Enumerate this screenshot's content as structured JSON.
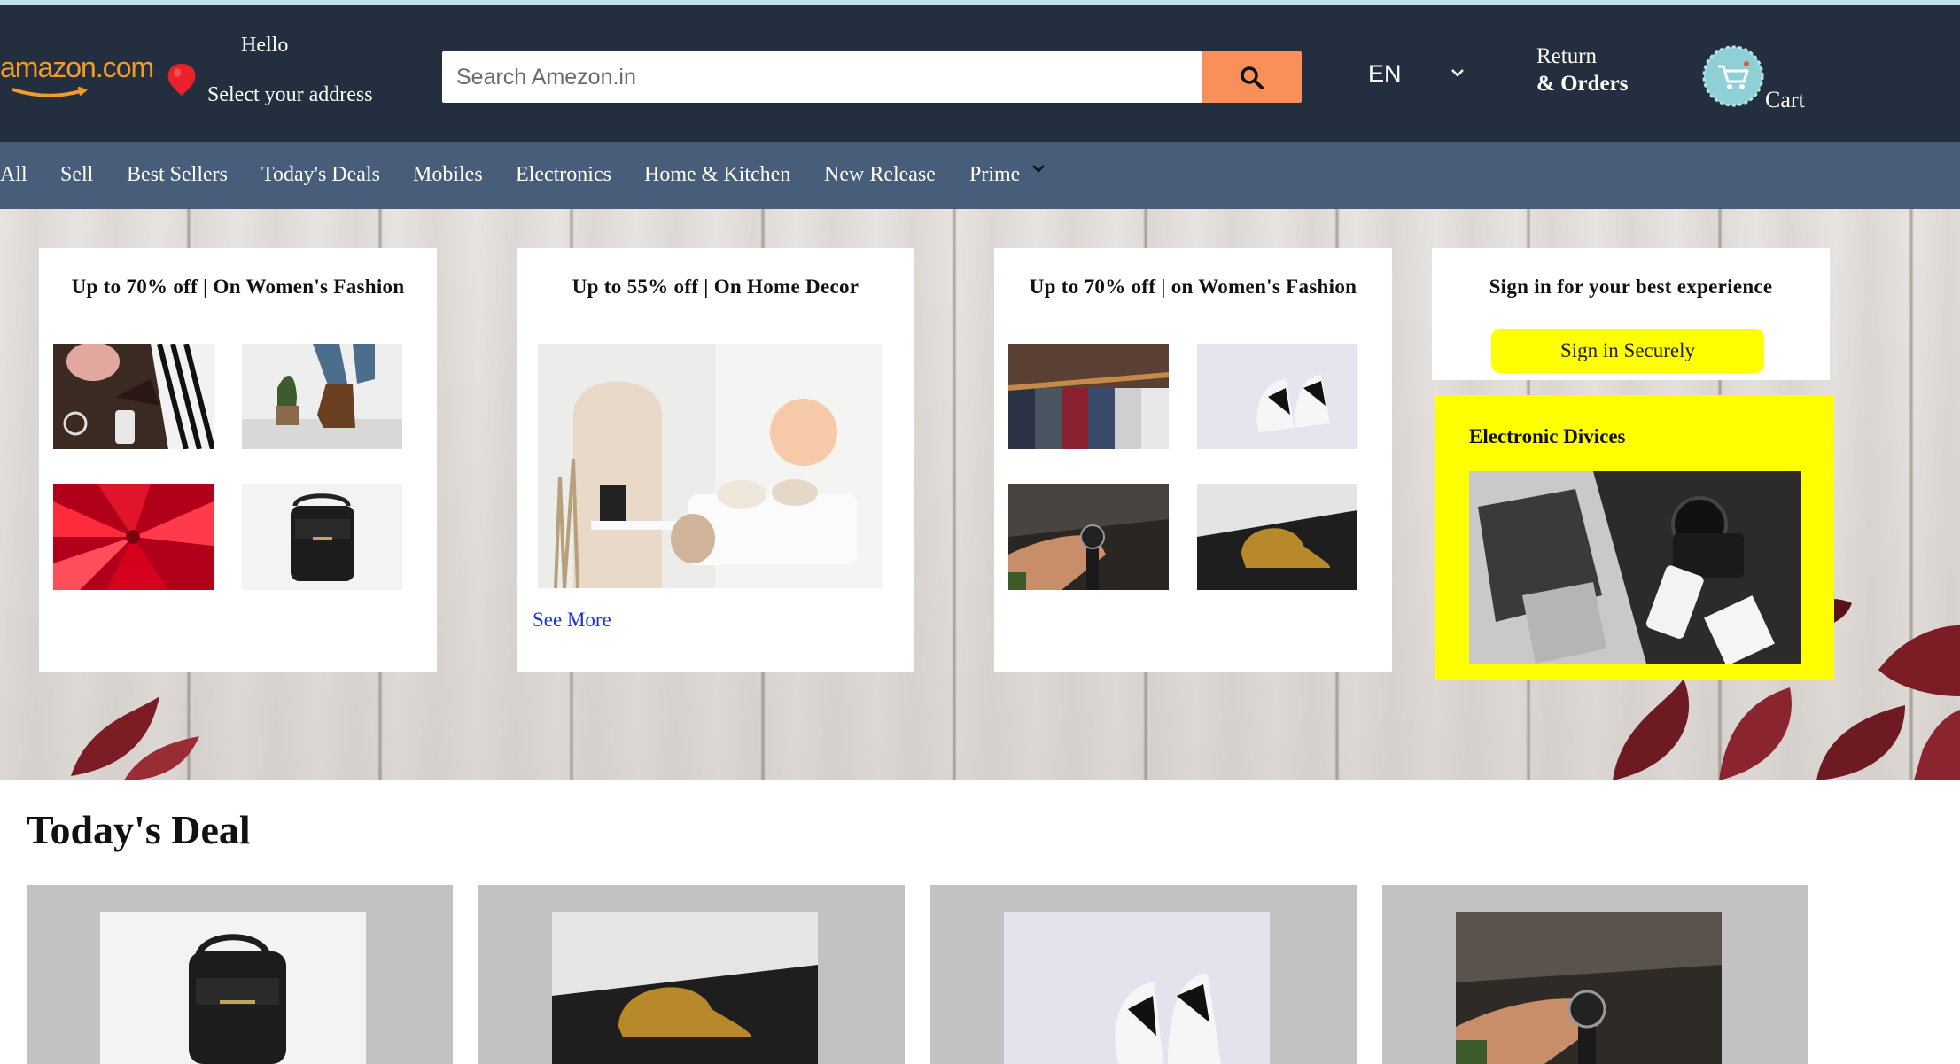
{
  "header": {
    "logo_text": "amazon.com",
    "hello": "Hello",
    "address_label": "Select your address",
    "search_placeholder": "Search Amezon.in",
    "language": "EN",
    "returns_line1": "Return",
    "returns_line2": "& Orders",
    "cart_label": "Cart",
    "colors": {
      "header_bg": "#232f3e",
      "logo": "#f39a2b",
      "search_button": "#f9905a"
    }
  },
  "nav": {
    "items": [
      "All",
      "Sell",
      "Best Sellers",
      "Today's Deals",
      "Mobiles",
      "Electronics",
      "Home & Kitchen",
      "New Release",
      "Prime"
    ],
    "bg": "#485d79"
  },
  "hero_cards": [
    {
      "title": "Up to 70% off | On Women's Fashion",
      "images": [
        "fashion-accessories",
        "boots",
        "lipsticks",
        "black-backpack"
      ]
    },
    {
      "title": "Up to 55% off | On Home Decor",
      "images": [
        "bedroom-interior"
      ],
      "link": "See More"
    },
    {
      "title": "Up to 70% off | on Women's Fashion",
      "images": [
        "shirts-on-hangers",
        "sneakers",
        "wristwatch-in-hand",
        "mustard-cap"
      ]
    },
    {
      "title": "Sign in for your best experience",
      "button": "Sign in Securely"
    }
  ],
  "electronics_card": {
    "title": "Electronic Divices",
    "image": "laptop-camera-phone",
    "bg": "#ffff00"
  },
  "todays_deal": {
    "title": "Today's Deal",
    "items": [
      "black-backpack",
      "mustard-cap",
      "sneakers",
      "wristwatch-in-hand"
    ]
  }
}
